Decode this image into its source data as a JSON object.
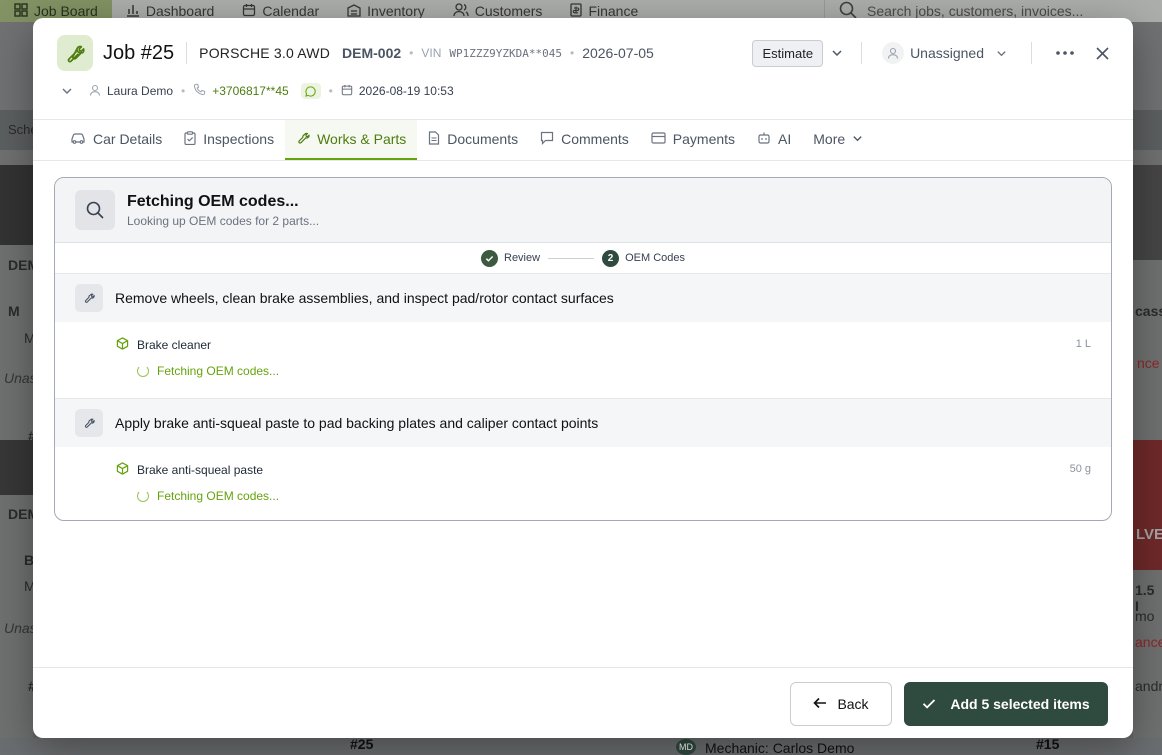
{
  "app_nav": {
    "items": [
      {
        "label": "Job Board",
        "icon": "grid-icon"
      },
      {
        "label": "Dashboard",
        "icon": "bar-chart-icon"
      },
      {
        "label": "Calendar",
        "icon": "calendar-icon"
      },
      {
        "label": "Inventory",
        "icon": "inventory-icon"
      },
      {
        "label": "Customers",
        "icon": "users-icon"
      },
      {
        "label": "Finance",
        "icon": "finance-icon"
      }
    ],
    "search_placeholder": "Search jobs, customers, invoices..."
  },
  "background": {
    "sched_label": "Sche",
    "card_plate_1": "DEM",
    "card_initial_1": "M",
    "card_initial_1b": "M",
    "card_unassigned_1": "Unas",
    "card_hash_1": "#",
    "card_plate_2": "DEM",
    "card_initial_2": "B",
    "card_initial_2b": "M",
    "card_unassigned_2": "Unas",
    "card_hash_2": "#",
    "right_text_1": "casso",
    "right_text_2": "nce",
    "right_text_3": "LVE",
    "right_text_4": "1.5 I",
    "right_text_5": "mo",
    "right_text_6": "ance",
    "right_text_7": "andr",
    "bottom_job_1": "#25",
    "bottom_mechanic": "Mechanic: Carlos Demo",
    "bottom_mechanic_initials": "MD",
    "bottom_job_2": "#15"
  },
  "job": {
    "title": "Job #25",
    "car": "PORSCHE 3.0 AWD",
    "plate": "DEM-002",
    "vin_label": "VIN",
    "vin": "WP1ZZZ9YZKDA**045",
    "date": "2026-07-05",
    "status": "Estimate",
    "assignee": "Unassigned",
    "customer": "Laura Demo",
    "phone": "+3706817**45",
    "appointment": "2026-08-19 10:53"
  },
  "tabs": [
    {
      "label": "Car Details",
      "icon": "car-icon",
      "active": false
    },
    {
      "label": "Inspections",
      "icon": "clipboard-check-icon",
      "active": false
    },
    {
      "label": "Works & Parts",
      "icon": "wrench-icon",
      "active": true
    },
    {
      "label": "Documents",
      "icon": "document-icon",
      "active": false
    },
    {
      "label": "Comments",
      "icon": "comment-icon",
      "active": false
    },
    {
      "label": "Payments",
      "icon": "credit-card-icon",
      "active": false
    },
    {
      "label": "AI",
      "icon": "robot-icon",
      "active": false
    },
    {
      "label": "More",
      "icon": "chevron-down-icon",
      "active": false
    }
  ],
  "oem": {
    "title": "Fetching OEM codes...",
    "subtitle": "Looking up OEM codes for 2 parts...",
    "steps": [
      {
        "number": "1",
        "label": "Review",
        "done": true
      },
      {
        "number": "2",
        "label": "OEM Codes",
        "done": false
      }
    ],
    "works": [
      {
        "title": "Remove wheels, clean brake assemblies, and inspect pad/rotor contact surfaces",
        "part": "Brake cleaner",
        "qty": "1 L",
        "status": "Fetching OEM codes..."
      },
      {
        "title": "Apply brake anti-squeal paste to pad backing plates and caliper contact points",
        "part": "Brake anti-squeal paste",
        "qty": "50 g",
        "status": "Fetching OEM codes..."
      }
    ]
  },
  "footer": {
    "back_label": "Back",
    "add_label": "Add 5 selected items"
  },
  "colors": {
    "accent": "#65a30d",
    "primary_button": "#2f4a3f"
  }
}
